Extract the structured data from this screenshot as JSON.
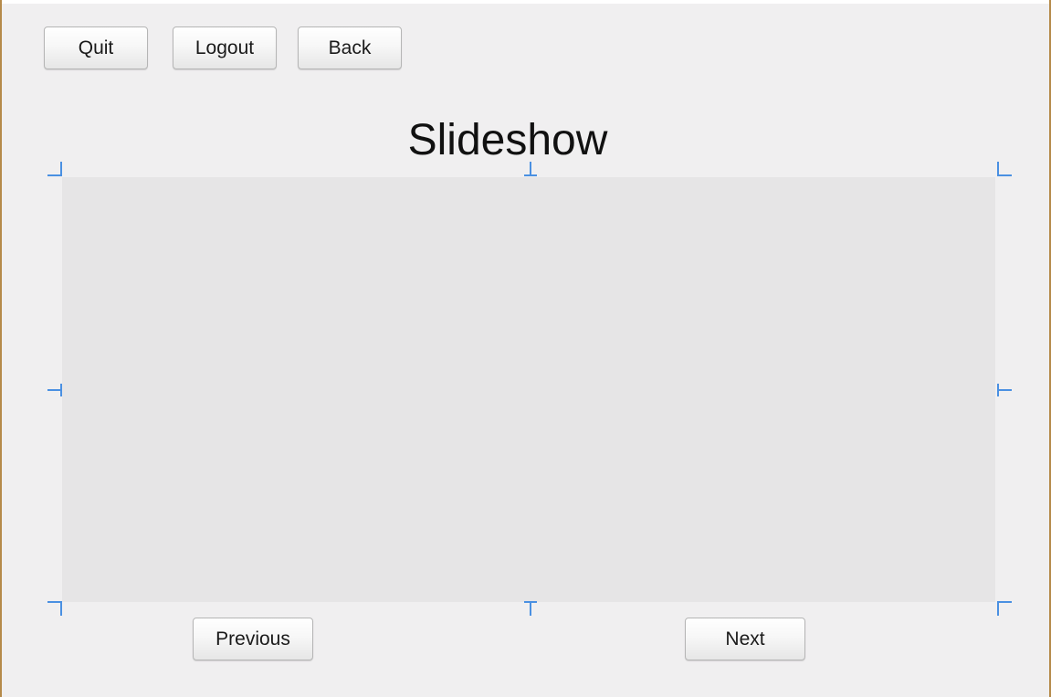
{
  "toolbar": {
    "quit_label": "Quit",
    "logout_label": "Logout",
    "back_label": "Back"
  },
  "page": {
    "title": "Slideshow"
  },
  "navigation": {
    "previous_label": "Previous",
    "next_label": "Next"
  },
  "colors": {
    "window_background": "#f0eff0",
    "slide_background": "#e6e5e6",
    "selection_handle": "#4a90e2",
    "window_border": "#b58a4a"
  }
}
